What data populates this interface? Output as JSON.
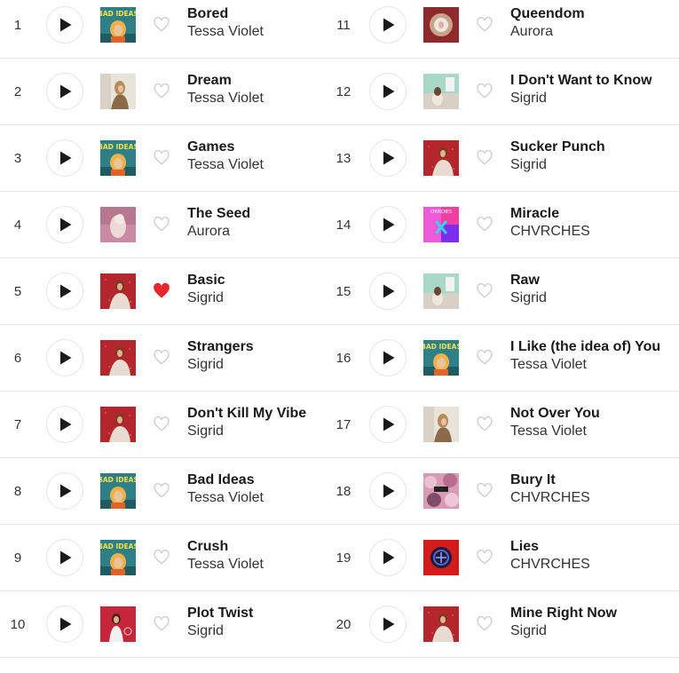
{
  "tracks": [
    {
      "rank": "1",
      "title": "Bored",
      "artist": "Tessa Violet",
      "art": "bad-ideas",
      "liked": false
    },
    {
      "rank": "2",
      "title": "Dream",
      "artist": "Tessa Violet",
      "art": "dream",
      "liked": false
    },
    {
      "rank": "3",
      "title": "Games",
      "artist": "Tessa Violet",
      "art": "bad-ideas",
      "liked": false
    },
    {
      "rank": "4",
      "title": "The Seed",
      "artist": "Aurora",
      "art": "the-seed",
      "liked": false
    },
    {
      "rank": "5",
      "title": "Basic",
      "artist": "Sigrid",
      "art": "sucker-punch",
      "liked": true
    },
    {
      "rank": "6",
      "title": "Strangers",
      "artist": "Sigrid",
      "art": "sucker-punch",
      "liked": false
    },
    {
      "rank": "7",
      "title": "Don't Kill My Vibe",
      "artist": "Sigrid",
      "art": "sucker-punch",
      "liked": false
    },
    {
      "rank": "8",
      "title": "Bad Ideas",
      "artist": "Tessa Violet",
      "art": "bad-ideas",
      "liked": false
    },
    {
      "rank": "9",
      "title": "Crush",
      "artist": "Tessa Violet",
      "art": "bad-ideas",
      "liked": false
    },
    {
      "rank": "10",
      "title": "Plot Twist",
      "artist": "Sigrid",
      "art": "plot-twist",
      "liked": false
    },
    {
      "rank": "11",
      "title": "Queendom",
      "artist": "Aurora",
      "art": "queendom",
      "liked": false
    },
    {
      "rank": "12",
      "title": "I Don't Want to Know",
      "artist": "Sigrid",
      "art": "raw",
      "liked": false
    },
    {
      "rank": "13",
      "title": "Sucker Punch",
      "artist": "Sigrid",
      "art": "sucker-punch",
      "liked": false
    },
    {
      "rank": "14",
      "title": "Miracle",
      "artist": "CHVRCHES",
      "art": "miracle",
      "liked": false
    },
    {
      "rank": "15",
      "title": "Raw",
      "artist": "Sigrid",
      "art": "raw",
      "liked": false
    },
    {
      "rank": "16",
      "title": "I Like (the idea of) You",
      "artist": "Tessa Violet",
      "art": "bad-ideas",
      "liked": false
    },
    {
      "rank": "17",
      "title": "Not Over You",
      "artist": "Tessa Violet",
      "art": "dream",
      "liked": false
    },
    {
      "rank": "18",
      "title": "Bury It",
      "artist": "CHVRCHES",
      "art": "bury-it",
      "liked": false
    },
    {
      "rank": "19",
      "title": "Lies",
      "artist": "CHVRCHES",
      "art": "lies",
      "liked": false
    },
    {
      "rank": "20",
      "title": "Mine Right Now",
      "artist": "Sigrid",
      "art": "sucker-punch",
      "liked": false
    }
  ],
  "album_art_text": {
    "bad-ideas": "BAD IDEAS",
    "miracle": "CHVRCHES"
  },
  "colors": {
    "heart_liked": "#e8262b",
    "heart_outline": "#cccccc",
    "play_icon": "#1a1a1a"
  }
}
